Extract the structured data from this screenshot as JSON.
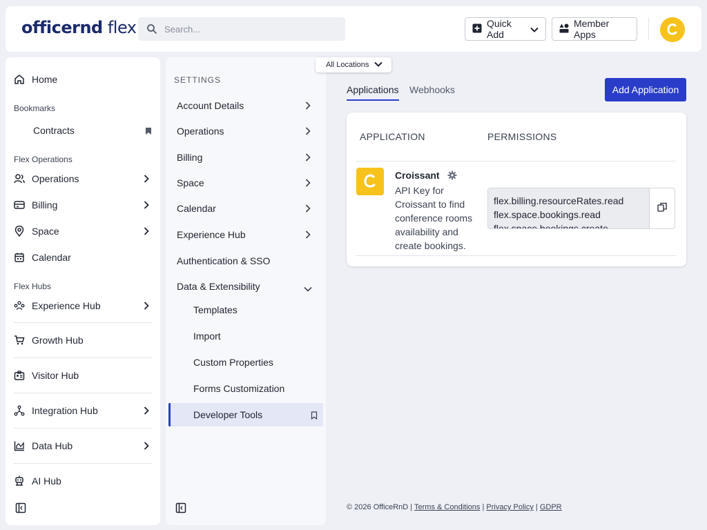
{
  "header": {
    "logo_text_bold": "officernd",
    "logo_text_light": " flex",
    "search_placeholder": "Search...",
    "quick_add_label": "Quick Add",
    "member_apps_label": "Member Apps"
  },
  "sidebar": {
    "home": "Home",
    "bookmarks_label": "Bookmarks",
    "contracts": "Contracts",
    "flex_operations_label": "Flex Operations",
    "operations": "Operations",
    "billing": "Billing",
    "space": "Space",
    "calendar": "Calendar",
    "flex_hubs_label": "Flex Hubs",
    "experience_hub": "Experience Hub",
    "growth_hub": "Growth Hub",
    "visitor_hub": "Visitor Hub",
    "integration_hub": "Integration Hub",
    "data_hub": "Data Hub",
    "ai_hub": "AI Hub"
  },
  "settings": {
    "title": "SETTINGS",
    "items": [
      "Account Details",
      "Operations",
      "Billing",
      "Space",
      "Calendar",
      "Experience Hub",
      "Authentication & SSO",
      "Data & Extensibility"
    ],
    "sub_items": [
      "Templates",
      "Import",
      "Custom Properties",
      "Forms Customization",
      "Developer Tools"
    ]
  },
  "location_selector": "All Locations",
  "main": {
    "tabs": [
      "Applications",
      "Webhooks"
    ],
    "add_button": "Add Application",
    "col_application": "APPLICATION",
    "col_permissions": "PERMISSIONS",
    "app": {
      "name": "Croissant",
      "description": "API Key for Croissant to find conference rooms availability and create bookings.",
      "permissions": [
        "flex.billing.resourceRates.read",
        "flex.space.bookings.read",
        "flex.space.bookings.create"
      ]
    }
  },
  "footer": {
    "copyright": "© 2026 OfficeRnD",
    "sep": "|",
    "terms": "Terms & Conditions",
    "privacy": "Privacy Policy",
    "gdpr": "GDPR"
  },
  "colors": {
    "accent": "#2a3dc9",
    "brand_yellow": "#f7c21c",
    "logo_navy": "#1b2a6b"
  }
}
